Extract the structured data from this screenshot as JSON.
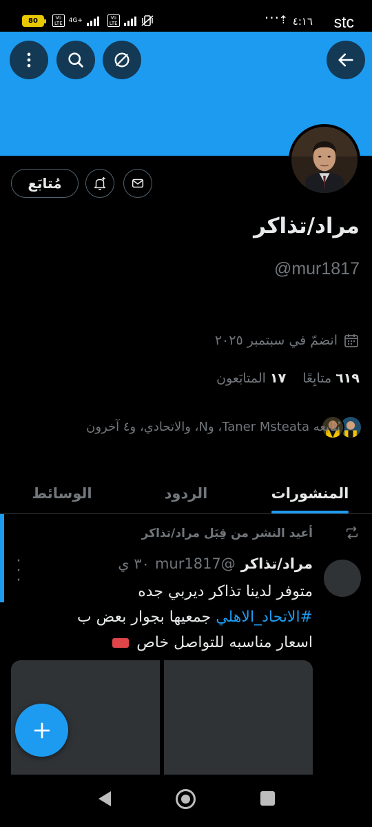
{
  "status_bar": {
    "carrier": "stc",
    "time": "٤:١٦",
    "upload_indicator": "⇡",
    "more_dots": "···",
    "battery": "80",
    "volte": "Vo\nLTE",
    "network": "4G+"
  },
  "header": {
    "back_icon": "arrow-left-icon",
    "icons": [
      "block-icon",
      "search-icon",
      "more-vertical-icon"
    ],
    "banner_color": "#1d9bf0"
  },
  "profile": {
    "name": "مراد/تذاكر",
    "handle": "@mur1817",
    "follow_button": "مُتابَع",
    "joined": "انضمّ في سبتمبر ٢٠٢٥",
    "following_count": "١٧",
    "following_label": "المتابَعون",
    "followers_count": "٦١٩",
    "followers_label": "متابِعًا",
    "followed_by": "يُتابعه Taner Msteata، وN، والاتحادي، و٤ آخرون"
  },
  "tabs": [
    {
      "label": "المنشورات",
      "active": true
    },
    {
      "label": "الردود",
      "active": false
    },
    {
      "label": "الوسائط",
      "active": false
    }
  ],
  "post": {
    "repost_label": "أعيد النشر من قِبَل مراد/تذاكر",
    "author_name": "مراد/تذاكر",
    "author_handle": "@mur1817",
    "time": "٣٠ ي",
    "more": "⋮",
    "line1": "متوفر لدينا تذاكر ديربي جده",
    "hashtag": "#الاتحاد_الاهلي",
    "line2_rest": " جمعيها بجوار بعض ب",
    "line3": "اسعار مناسبه للتواصل خاص"
  },
  "accent_color": "#1d9bf0"
}
